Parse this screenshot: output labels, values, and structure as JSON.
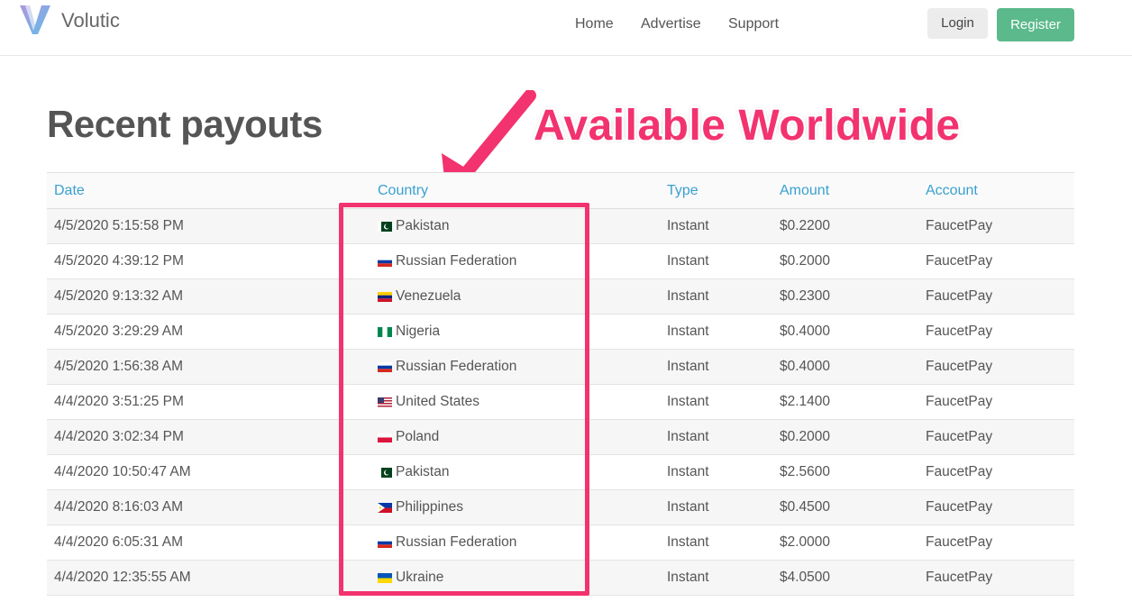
{
  "brand": {
    "name": "Volutic"
  },
  "nav": {
    "home": "Home",
    "advertise": "Advertise",
    "support": "Support"
  },
  "auth": {
    "login": "Login",
    "register": "Register"
  },
  "page_title": "Recent payouts",
  "annotation": {
    "text": "Available Worldwide",
    "color": "#f2336f"
  },
  "table": {
    "headers": {
      "date": "Date",
      "country": "Country",
      "type": "Type",
      "amount": "Amount",
      "account": "Account"
    },
    "rows": [
      {
        "date": "4/5/2020 5:15:58 PM",
        "flag": "pk-flag-icon",
        "country": "Pakistan",
        "type": "Instant",
        "amount": "$0.2200",
        "account": "FaucetPay"
      },
      {
        "date": "4/5/2020 4:39:12 PM",
        "flag": "ru-flag-icon",
        "country": "Russian Federation",
        "type": "Instant",
        "amount": "$0.2000",
        "account": "FaucetPay"
      },
      {
        "date": "4/5/2020 9:13:32 AM",
        "flag": "ve-flag-icon",
        "country": "Venezuela",
        "type": "Instant",
        "amount": "$0.2300",
        "account": "FaucetPay"
      },
      {
        "date": "4/5/2020 3:29:29 AM",
        "flag": "ng-flag-icon",
        "country": "Nigeria",
        "type": "Instant",
        "amount": "$0.4000",
        "account": "FaucetPay"
      },
      {
        "date": "4/5/2020 1:56:38 AM",
        "flag": "ru-flag-icon",
        "country": "Russian Federation",
        "type": "Instant",
        "amount": "$0.4000",
        "account": "FaucetPay"
      },
      {
        "date": "4/4/2020 3:51:25 PM",
        "flag": "us-flag-icon",
        "country": "United States",
        "type": "Instant",
        "amount": "$2.1400",
        "account": "FaucetPay"
      },
      {
        "date": "4/4/2020 3:02:34 PM",
        "flag": "pl-flag-icon",
        "country": "Poland",
        "type": "Instant",
        "amount": "$0.2000",
        "account": "FaucetPay"
      },
      {
        "date": "4/4/2020 10:50:47 AM",
        "flag": "pk-flag-icon",
        "country": "Pakistan",
        "type": "Instant",
        "amount": "$2.5600",
        "account": "FaucetPay"
      },
      {
        "date": "4/4/2020 8:16:03 AM",
        "flag": "ph-flag-icon",
        "country": "Philippines",
        "type": "Instant",
        "amount": "$0.4500",
        "account": "FaucetPay"
      },
      {
        "date": "4/4/2020 6:05:31 AM",
        "flag": "ru-flag-icon",
        "country": "Russian Federation",
        "type": "Instant",
        "amount": "$2.0000",
        "account": "FaucetPay"
      },
      {
        "date": "4/4/2020 12:35:55 AM",
        "flag": "ua-flag-icon",
        "country": "Ukraine",
        "type": "Instant",
        "amount": "$4.0500",
        "account": "FaucetPay"
      }
    ]
  }
}
